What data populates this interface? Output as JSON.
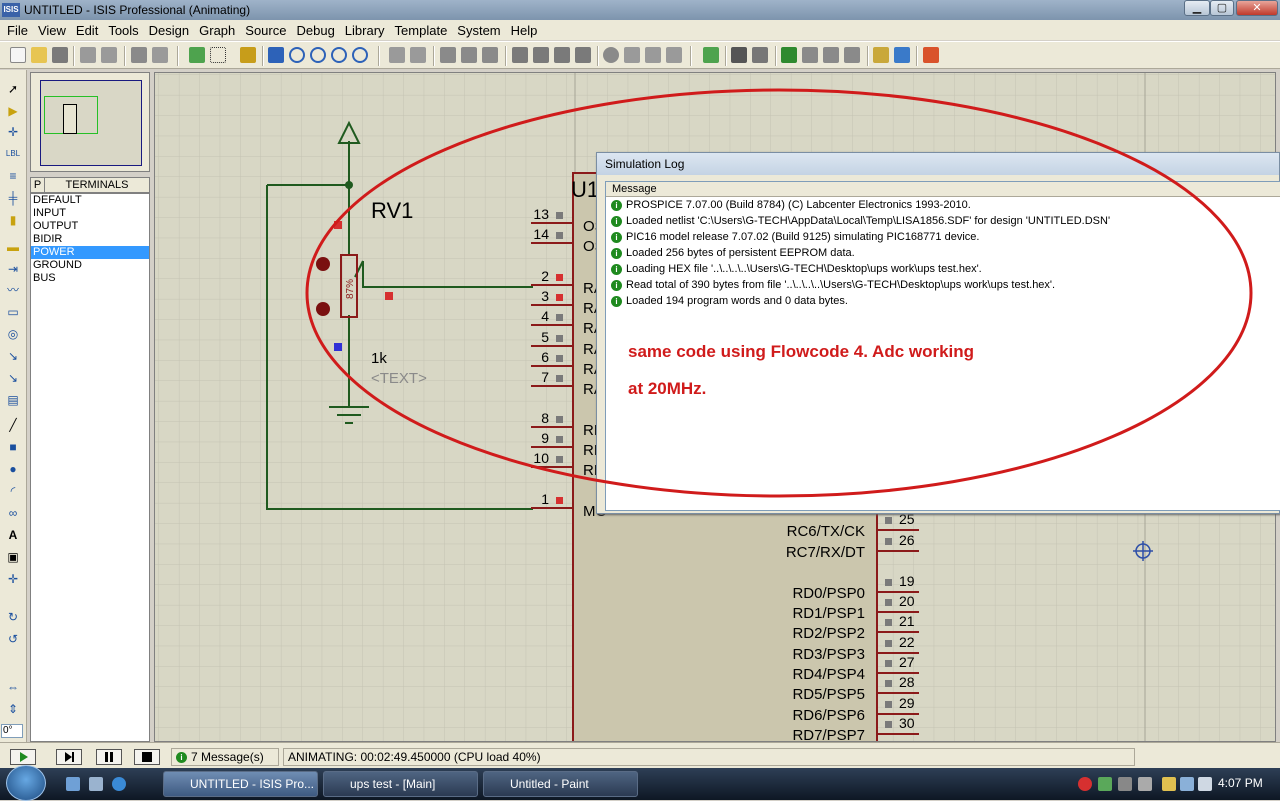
{
  "window": {
    "title": "UNTITLED - ISIS Professional (Animating)",
    "app_icon": "ISIS",
    "min": "▁",
    "max": "▢",
    "close": "✕"
  },
  "menu": [
    "File",
    "View",
    "Edit",
    "Tools",
    "Design",
    "Graph",
    "Source",
    "Debug",
    "Library",
    "Template",
    "System",
    "Help"
  ],
  "terminals": {
    "tab": "P",
    "title": "TERMINALS",
    "items": [
      "DEFAULT",
      "INPUT",
      "OUTPUT",
      "BIDIR",
      "POWER",
      "GROUND",
      "BUS"
    ],
    "selected": "POWER"
  },
  "rotation": "0°",
  "schematic": {
    "component_ref": "U1",
    "pot": {
      "ref": "RV1",
      "percent": "87%",
      "value": "1k",
      "text": "<TEXT>"
    },
    "left_pins": [
      {
        "num": "13",
        "label": "OS"
      },
      {
        "num": "14",
        "label": "OS"
      },
      {
        "num": "2",
        "label": "RA"
      },
      {
        "num": "3",
        "label": "RA"
      },
      {
        "num": "4",
        "label": "RA"
      },
      {
        "num": "5",
        "label": "RA"
      },
      {
        "num": "6",
        "label": "RA"
      },
      {
        "num": "7",
        "label": "RA"
      },
      {
        "num": "8",
        "label": "RE"
      },
      {
        "num": "9",
        "label": "RE"
      },
      {
        "num": "10",
        "label": "RE"
      },
      {
        "num": "1",
        "label": "MC"
      }
    ],
    "right_pins": [
      {
        "num": "25",
        "label": "RC6/TX/CK"
      },
      {
        "num": "26",
        "label": "RC7/RX/DT"
      },
      {
        "num": "19",
        "label": "RD0/PSP0"
      },
      {
        "num": "20",
        "label": "RD1/PSP1"
      },
      {
        "num": "21",
        "label": "RD2/PSP2"
      },
      {
        "num": "22",
        "label": "RD3/PSP3"
      },
      {
        "num": "27",
        "label": "RD4/PSP4"
      },
      {
        "num": "28",
        "label": "RD5/PSP5"
      },
      {
        "num": "29",
        "label": "RD6/PSP6"
      },
      {
        "num": "30",
        "label": "RD7/PSP7"
      }
    ]
  },
  "simlog": {
    "title": "Simulation Log",
    "column": "Message",
    "rows": [
      "PROSPICE 7.07.00 (Build 8784) (C) Labcenter Electronics 1993-2010.",
      "Loaded netlist 'C:\\Users\\G-TECH\\AppData\\Local\\Temp\\LISA1856.SDF' for design 'UNTITLED.DSN'",
      "PIC16 model release 7.07.02 (Build 9125) simulating PIC168771 device.",
      "Loaded 256 bytes of persistent EEPROM data.",
      "Loading HEX file '..\\..\\..\\..\\Users\\G-TECH\\Desktop\\ups work\\ups test.hex'.",
      "Read total of 390 bytes from file '..\\..\\..\\..\\Users\\G-TECH\\Desktop\\ups work\\ups test.hex'.",
      "Loaded 194 program words and 0 data bytes."
    ],
    "note_line1": "same code using Flowcode 4. Adc working",
    "note_line2": "at 20MHz."
  },
  "status": {
    "messages": "7 Message(s)",
    "animating": "ANIMATING: 00:02:49.450000 (CPU load 40%)"
  },
  "taskbar": {
    "items": [
      "UNTITLED - ISIS Pro...",
      "ups test - [Main]",
      "Untitled - Paint"
    ],
    "clock": "4:07 PM"
  },
  "colors": {
    "wire": "#1f5a1f",
    "component": "#8b1a1a",
    "annotation": "#d01b1b",
    "grid": "#c4c3b2"
  }
}
